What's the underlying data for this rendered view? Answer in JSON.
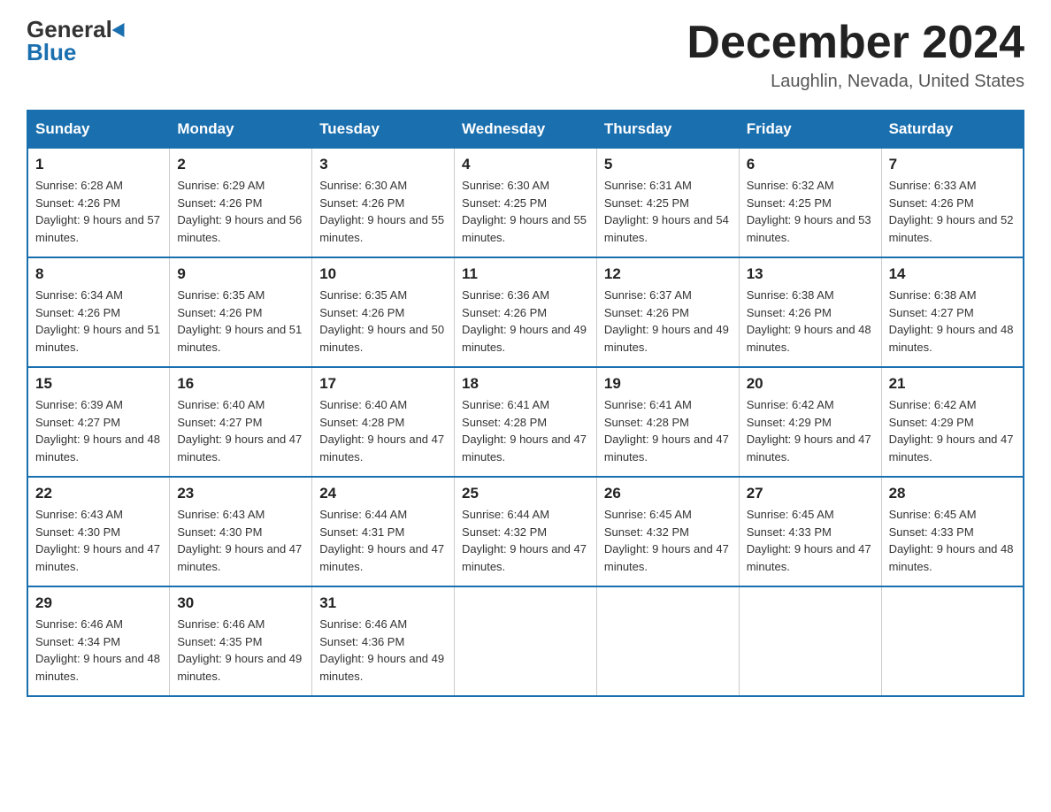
{
  "logo": {
    "general": "General",
    "blue": "Blue"
  },
  "title": "December 2024",
  "subtitle": "Laughlin, Nevada, United States",
  "weekdays": [
    "Sunday",
    "Monday",
    "Tuesday",
    "Wednesday",
    "Thursday",
    "Friday",
    "Saturday"
  ],
  "weeks": [
    [
      {
        "day": "1",
        "sunrise": "6:28 AM",
        "sunset": "4:26 PM",
        "daylight": "9 hours and 57 minutes."
      },
      {
        "day": "2",
        "sunrise": "6:29 AM",
        "sunset": "4:26 PM",
        "daylight": "9 hours and 56 minutes."
      },
      {
        "day": "3",
        "sunrise": "6:30 AM",
        "sunset": "4:26 PM",
        "daylight": "9 hours and 55 minutes."
      },
      {
        "day": "4",
        "sunrise": "6:30 AM",
        "sunset": "4:25 PM",
        "daylight": "9 hours and 55 minutes."
      },
      {
        "day": "5",
        "sunrise": "6:31 AM",
        "sunset": "4:25 PM",
        "daylight": "9 hours and 54 minutes."
      },
      {
        "day": "6",
        "sunrise": "6:32 AM",
        "sunset": "4:25 PM",
        "daylight": "9 hours and 53 minutes."
      },
      {
        "day": "7",
        "sunrise": "6:33 AM",
        "sunset": "4:26 PM",
        "daylight": "9 hours and 52 minutes."
      }
    ],
    [
      {
        "day": "8",
        "sunrise": "6:34 AM",
        "sunset": "4:26 PM",
        "daylight": "9 hours and 51 minutes."
      },
      {
        "day": "9",
        "sunrise": "6:35 AM",
        "sunset": "4:26 PM",
        "daylight": "9 hours and 51 minutes."
      },
      {
        "day": "10",
        "sunrise": "6:35 AM",
        "sunset": "4:26 PM",
        "daylight": "9 hours and 50 minutes."
      },
      {
        "day": "11",
        "sunrise": "6:36 AM",
        "sunset": "4:26 PM",
        "daylight": "9 hours and 49 minutes."
      },
      {
        "day": "12",
        "sunrise": "6:37 AM",
        "sunset": "4:26 PM",
        "daylight": "9 hours and 49 minutes."
      },
      {
        "day": "13",
        "sunrise": "6:38 AM",
        "sunset": "4:26 PM",
        "daylight": "9 hours and 48 minutes."
      },
      {
        "day": "14",
        "sunrise": "6:38 AM",
        "sunset": "4:27 PM",
        "daylight": "9 hours and 48 minutes."
      }
    ],
    [
      {
        "day": "15",
        "sunrise": "6:39 AM",
        "sunset": "4:27 PM",
        "daylight": "9 hours and 48 minutes."
      },
      {
        "day": "16",
        "sunrise": "6:40 AM",
        "sunset": "4:27 PM",
        "daylight": "9 hours and 47 minutes."
      },
      {
        "day": "17",
        "sunrise": "6:40 AM",
        "sunset": "4:28 PM",
        "daylight": "9 hours and 47 minutes."
      },
      {
        "day": "18",
        "sunrise": "6:41 AM",
        "sunset": "4:28 PM",
        "daylight": "9 hours and 47 minutes."
      },
      {
        "day": "19",
        "sunrise": "6:41 AM",
        "sunset": "4:28 PM",
        "daylight": "9 hours and 47 minutes."
      },
      {
        "day": "20",
        "sunrise": "6:42 AM",
        "sunset": "4:29 PM",
        "daylight": "9 hours and 47 minutes."
      },
      {
        "day": "21",
        "sunrise": "6:42 AM",
        "sunset": "4:29 PM",
        "daylight": "9 hours and 47 minutes."
      }
    ],
    [
      {
        "day": "22",
        "sunrise": "6:43 AM",
        "sunset": "4:30 PM",
        "daylight": "9 hours and 47 minutes."
      },
      {
        "day": "23",
        "sunrise": "6:43 AM",
        "sunset": "4:30 PM",
        "daylight": "9 hours and 47 minutes."
      },
      {
        "day": "24",
        "sunrise": "6:44 AM",
        "sunset": "4:31 PM",
        "daylight": "9 hours and 47 minutes."
      },
      {
        "day": "25",
        "sunrise": "6:44 AM",
        "sunset": "4:32 PM",
        "daylight": "9 hours and 47 minutes."
      },
      {
        "day": "26",
        "sunrise": "6:45 AM",
        "sunset": "4:32 PM",
        "daylight": "9 hours and 47 minutes."
      },
      {
        "day": "27",
        "sunrise": "6:45 AM",
        "sunset": "4:33 PM",
        "daylight": "9 hours and 47 minutes."
      },
      {
        "day": "28",
        "sunrise": "6:45 AM",
        "sunset": "4:33 PM",
        "daylight": "9 hours and 48 minutes."
      }
    ],
    [
      {
        "day": "29",
        "sunrise": "6:46 AM",
        "sunset": "4:34 PM",
        "daylight": "9 hours and 48 minutes."
      },
      {
        "day": "30",
        "sunrise": "6:46 AM",
        "sunset": "4:35 PM",
        "daylight": "9 hours and 49 minutes."
      },
      {
        "day": "31",
        "sunrise": "6:46 AM",
        "sunset": "4:36 PM",
        "daylight": "9 hours and 49 minutes."
      },
      null,
      null,
      null,
      null
    ]
  ]
}
